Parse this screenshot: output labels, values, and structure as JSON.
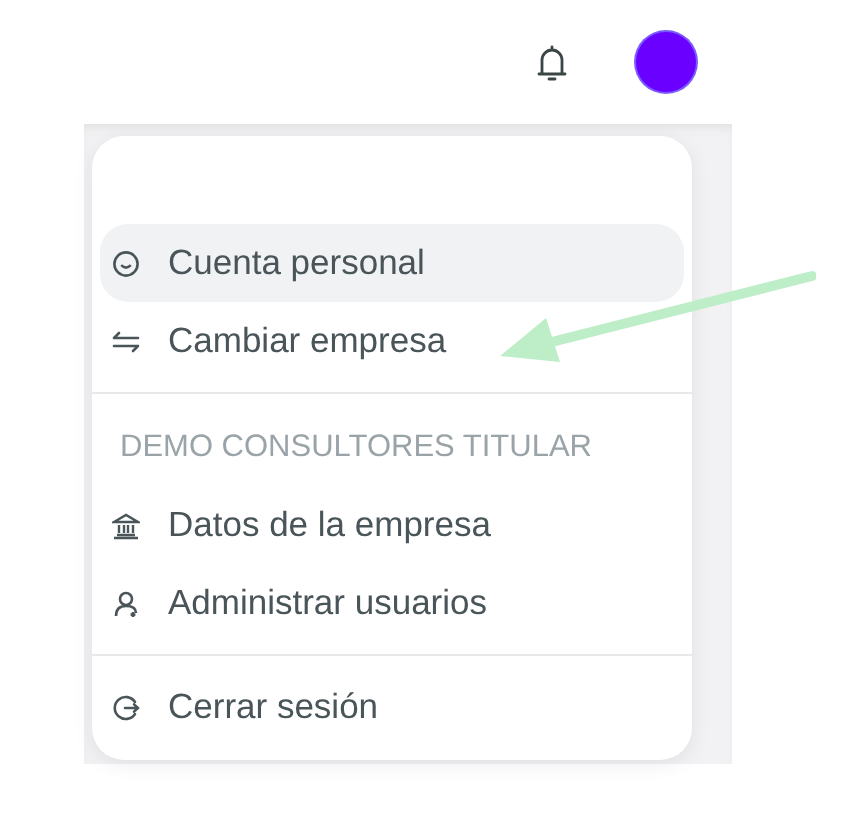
{
  "header": {
    "avatar": {
      "color": "#6a00ff"
    }
  },
  "menu": {
    "sections": [
      {
        "items": [
          {
            "label": "Cuenta personal",
            "selected": true
          },
          {
            "label": "Cambiar empresa",
            "selected": false
          }
        ]
      },
      {
        "heading": "DEMO CONSULTORES TITULAR",
        "items": [
          {
            "label": "Datos de la empresa",
            "selected": false
          },
          {
            "label": "Administrar usuarios",
            "selected": false
          }
        ]
      },
      {
        "items": [
          {
            "label": "Cerrar sesión",
            "selected": false
          }
        ]
      }
    ]
  },
  "annotation": {
    "kind": "arrow"
  }
}
